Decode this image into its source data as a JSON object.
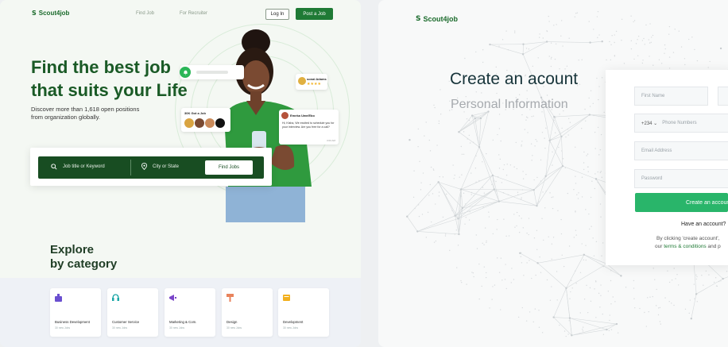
{
  "brand": {
    "name": "Scout4job",
    "mark": "S",
    "color": "#1b6b2c"
  },
  "landing": {
    "nav": {
      "links": [
        "Find Job",
        "For Recruiter"
      ],
      "login": "Log In",
      "post_job": "Post a Job"
    },
    "hero": {
      "title_line1": "Find the best job",
      "title_line2": "that suits your Life",
      "subtitle_line1": "Discover more than 1,618 open positions",
      "subtitle_line2": "from organization globally."
    },
    "cards": {
      "got_job": "30K Got a Job",
      "rating_name": "sonal Adams",
      "rating_stars": "★★★★",
      "msg_name": "Emeka Uwe/Ebo",
      "msg_text": "Hi, Kisha, We excited to schedule you for your interview. Are you free for a call?",
      "msg_time": "3:00 AM"
    },
    "search": {
      "keyword_placeholder": "Job title or Keyword",
      "location_placeholder": "City or State",
      "button": "Find Jobs"
    },
    "explore": {
      "line1": "Explore",
      "line2": "by category"
    },
    "categories": [
      {
        "label": "Business Development",
        "count": "30 new Jobs",
        "color": "#6a4fd0"
      },
      {
        "label": "Customer Service",
        "count": "30 new Jobs",
        "color": "#1aa6a6"
      },
      {
        "label": "Marketing & Com.",
        "count": "30 new Jobs",
        "color": "#7a45c9"
      },
      {
        "label": "Design",
        "count": "30 new Jobs",
        "color": "#e8835c"
      },
      {
        "label": "Development",
        "count": "30 new Jobs",
        "color": "#f2b01e"
      }
    ]
  },
  "signup": {
    "title": "Create an acount",
    "subtitle": "Personal Information",
    "first_name": "First Name",
    "country_code": "+234 ⌄",
    "phone": "Phone Numbers",
    "email": "Email Address",
    "password": "Password",
    "create_button": "Create an account",
    "have_account": "Have an account?",
    "terms_line1": "By clicking 'create account',",
    "terms_prefix": "our",
    "terms_link": "terms & conditions",
    "terms_suffix": "and p"
  },
  "colors": {
    "primary": "#1f7a35",
    "dark_green": "#184d22",
    "create_green": "#29b56a"
  }
}
